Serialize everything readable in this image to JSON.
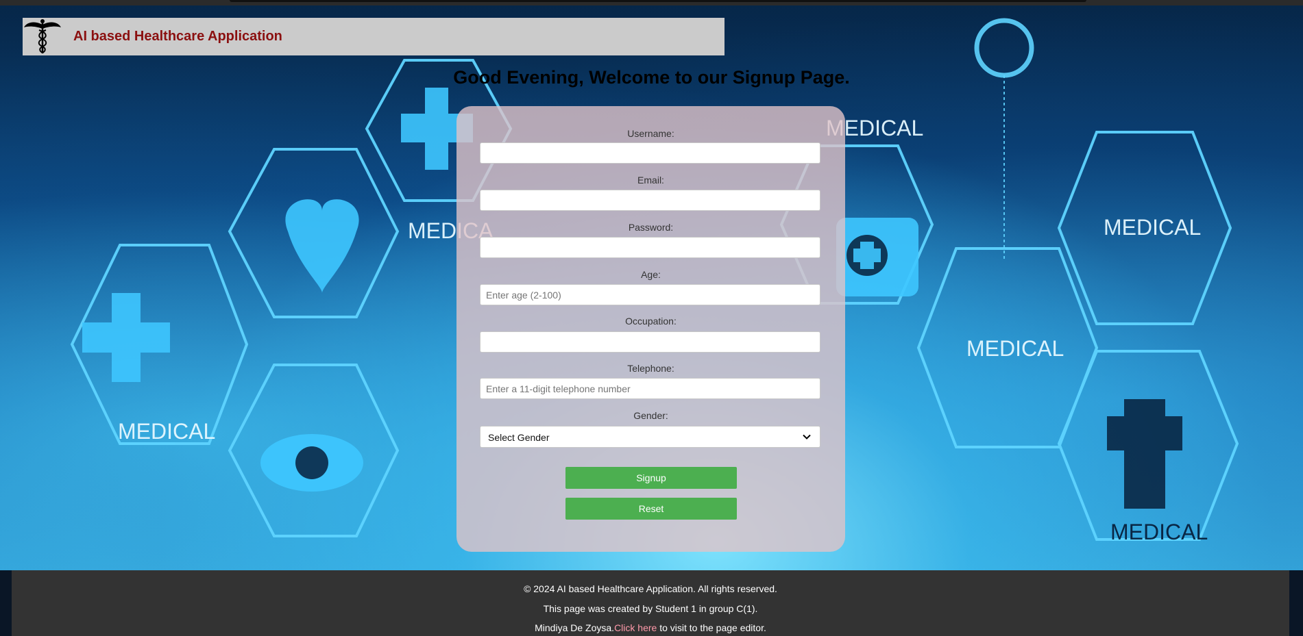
{
  "header": {
    "logo_icon": "caduceus-icon",
    "title": "AI based Healthcare Application"
  },
  "welcome": "Good Evening, Welcome to our Signup Page.",
  "form": {
    "username": {
      "label": "Username:",
      "value": "",
      "placeholder": ""
    },
    "email": {
      "label": "Email:",
      "value": "",
      "placeholder": ""
    },
    "password": {
      "label": "Password:",
      "value": "",
      "placeholder": ""
    },
    "age": {
      "label": "Age:",
      "value": "",
      "placeholder": "Enter age (2-100)"
    },
    "occupation": {
      "label": "Occupation:",
      "value": "",
      "placeholder": ""
    },
    "telephone": {
      "label": "Telephone:",
      "value": "",
      "placeholder": "Enter a 11-digit telephone number"
    },
    "gender": {
      "label": "Gender:",
      "selected": "Select Gender"
    },
    "signup_label": "Signup",
    "reset_label": "Reset"
  },
  "background": {
    "hex_labels": [
      "MEDICAL",
      "MEDICAL",
      "MEDICAL",
      "MEDICAL",
      "MEDICAL",
      "MEDICAL",
      "MEDICA"
    ]
  },
  "footer": {
    "copyright": "© 2024 AI based Healthcare Application. All rights reserved.",
    "created_by": "This page was created by Student 1 in group C(1).",
    "author": "Mindiya De Zoysa.",
    "link_text": "Click here",
    "link_suffix": " to visit to the page editor."
  },
  "colors": {
    "header_bg": "#cbcbcb",
    "title_color": "#8b1010",
    "button_green": "#4caf50",
    "footer_bg": "#333333",
    "link_color": "#ff9aaa"
  }
}
